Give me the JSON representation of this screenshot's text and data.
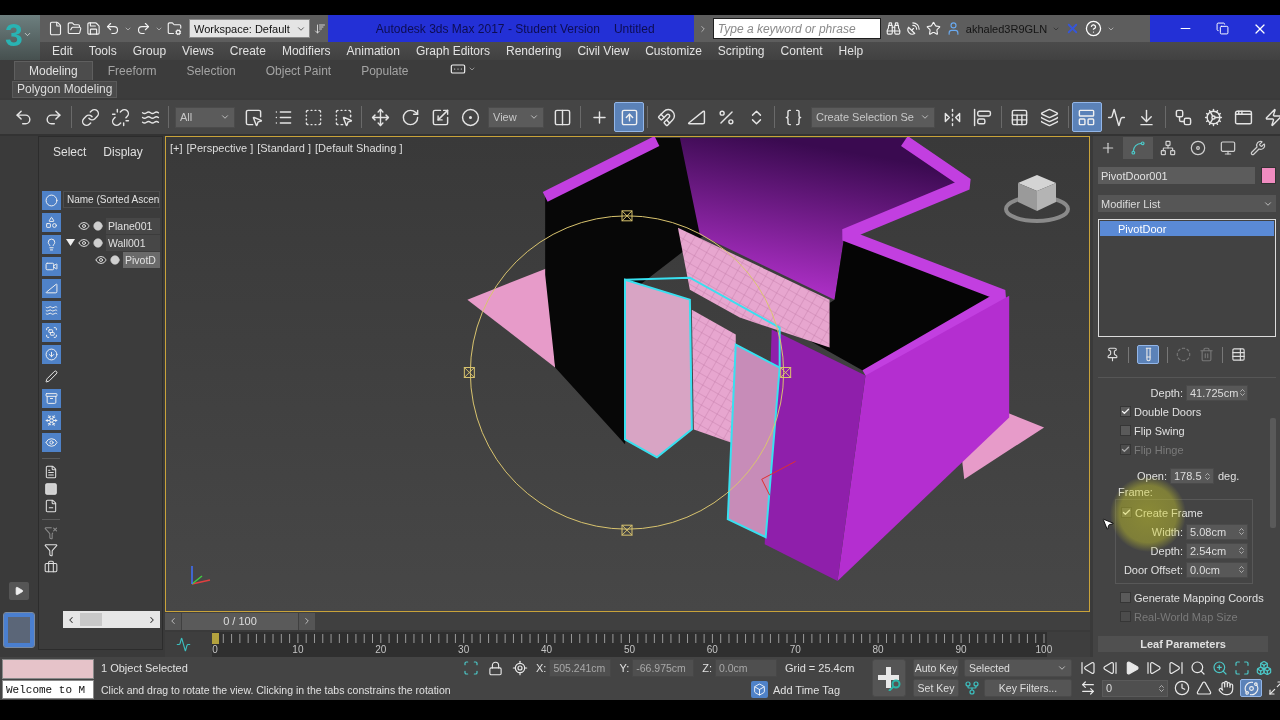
{
  "title_bar": {
    "logo": "3",
    "workspace": "Workspace: Default",
    "app_title": "Autodesk 3ds Max 2017 - Student Version",
    "document": "Untitled",
    "search": {
      "placeholder": "Type a keyword or phrase"
    },
    "user": "akhaled3R9GLN"
  },
  "menu_bar": [
    "Edit",
    "Tools",
    "Group",
    "Views",
    "Create",
    "Modifiers",
    "Animation",
    "Graph Editors",
    "Rendering",
    "Civil View",
    "Customize",
    "Scripting",
    "Content",
    "Help"
  ],
  "ribbon": {
    "tabs": [
      {
        "label": "Modeling",
        "selected": true
      },
      {
        "label": "Freeform",
        "selected": false
      },
      {
        "label": "Selection",
        "selected": false
      },
      {
        "label": "Object Paint",
        "selected": false
      },
      {
        "label": "Populate",
        "selected": false
      }
    ],
    "panel": "Polygon Modeling"
  },
  "main_toolbar": {
    "selection_filter": "All",
    "reference_coordinate_system": "View",
    "named_selection_set": "Create Selection Se",
    "shortcut_override_on": true,
    "ribbon_toggle_on": true
  },
  "scene_explorer": {
    "menus": [
      "Select",
      "Display"
    ],
    "filters": [
      {
        "on": true
      },
      {
        "on": true
      },
      {
        "on": true
      },
      {
        "on": true
      },
      {
        "on": true
      },
      {
        "on": true
      },
      {
        "on": true
      },
      {
        "on": true
      },
      {
        "on": false
      },
      {
        "on": true
      },
      {
        "on": true
      },
      {
        "on": true
      }
    ],
    "column": "Name (Sorted Ascen",
    "tree": [
      {
        "name": "Plane001",
        "selected": false
      },
      {
        "name": "Wall001",
        "selected": false,
        "expanded": true,
        "children": [
          {
            "name": "PivotD",
            "selected": true
          }
        ]
      }
    ]
  },
  "viewport": {
    "active": true,
    "labels": [
      "[+]",
      "[Perspective ]",
      "[Standard ]",
      "[Default Shading ]"
    ]
  },
  "command_panel": {
    "tabs": [
      {
        "selected": false
      },
      {
        "selected": true
      },
      {
        "selected": false
      },
      {
        "selected": false
      },
      {
        "selected": false
      },
      {
        "selected": false
      }
    ],
    "object_name": "PivotDoor001",
    "modifier_list": "Modifier List",
    "stack": [
      {
        "name": "PivotDoor",
        "selected": true
      }
    ],
    "show_end_result_on": true,
    "parameters": [
      {
        "kind": "spinner",
        "label": "Depth:",
        "value": "41.725cm"
      },
      {
        "kind": "checkbox",
        "label": "Double Doors",
        "checked": true,
        "disabled": false
      },
      {
        "kind": "checkbox",
        "label": "Flip Swing",
        "checked": false,
        "disabled": false
      },
      {
        "kind": "checkbox",
        "label": "Flip Hinge",
        "checked": true,
        "disabled": true
      },
      {
        "kind": "spinner",
        "label": "Open:",
        "value": "178.5",
        "unit": "deg."
      },
      {
        "kind": "group",
        "title": "Frame:",
        "items": [
          {
            "kind": "checkbox",
            "label": "Create Frame",
            "checked": true,
            "disabled": false
          },
          {
            "kind": "spinner",
            "label": "Width:",
            "value": "5.08cm"
          },
          {
            "kind": "spinner",
            "label": "Depth:",
            "value": "2.54cm"
          },
          {
            "kind": "spinner",
            "label": "Door Offset:",
            "value": "0.0cm"
          }
        ]
      },
      {
        "kind": "checkbox",
        "label": "Generate Mapping Coords",
        "checked": false,
        "disabled": false
      },
      {
        "kind": "checkbox",
        "label": "Real-World Map Size",
        "checked": false,
        "disabled": true
      },
      {
        "kind": "rollout",
        "label": "Leaf Parameters"
      }
    ]
  },
  "time_slider": {
    "label": "0 / 100",
    "level": 0
  },
  "track_bar": {
    "labels": [
      "0",
      "10",
      "20",
      "30",
      "40",
      "50",
      "60",
      "70",
      "80",
      "90",
      "100"
    ]
  },
  "status_bar": {
    "listener_output": "Welcome to M",
    "selection": "1 Object Selected",
    "prompt": "Click and drag to rotate the view.  Clicking in the tabs constrains the rotation",
    "coordinates": [
      {
        "label": "X:",
        "value": "505.241cm"
      },
      {
        "label": "Y:",
        "value": "-66.975cm"
      },
      {
        "label": "Z:",
        "value": "0.0cm"
      }
    ],
    "grid": "Grid = 25.4cm",
    "time_tag": "Add Time Tag"
  },
  "animation_controls": {
    "auto_key": "Auto Key",
    "key_set": "Selected",
    "set_key": "Set Key",
    "key_filters": "Key Filters...",
    "frame": "0"
  },
  "viewport_navigation": {
    "orbit_on": true
  }
}
